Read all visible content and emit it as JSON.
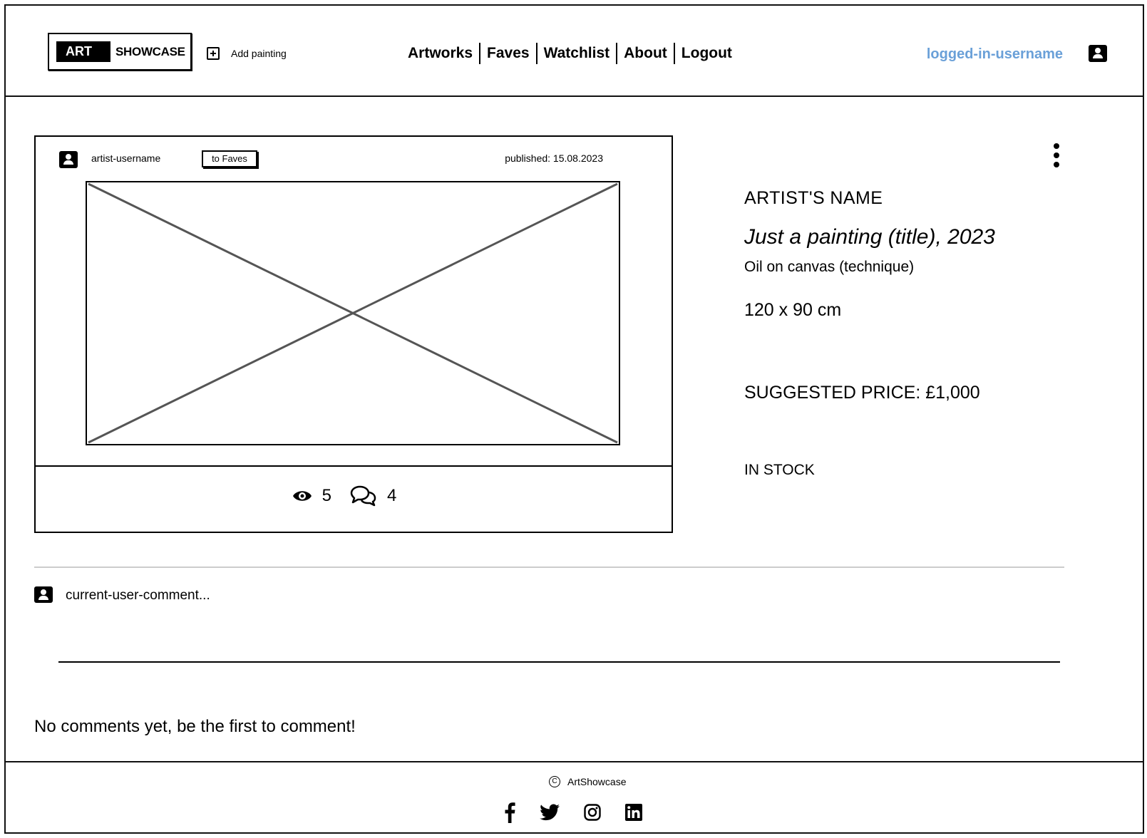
{
  "header": {
    "logo": {
      "part1": "ART",
      "part2": "SHOWCASE"
    },
    "add_painting": "Add painting",
    "nav": [
      "Artworks",
      "Faves",
      "Watchlist",
      "About",
      "Logout"
    ],
    "username": "logged-in-username"
  },
  "card": {
    "artist_username": "artist-username",
    "faves_button": "to Faves",
    "published": "published: 15.08.2023",
    "views": "5",
    "comments": "4"
  },
  "details": {
    "artist_name": "ARTIST'S NAME",
    "title": "Just a painting (title), 2023",
    "technique": "Oil on canvas (technique)",
    "dimensions": "120 x 90 cm",
    "price": "SUGGESTED PRICE: £1,000",
    "stock": "IN STOCK"
  },
  "comment_form": {
    "placeholder": "current-user-comment..."
  },
  "comments": {
    "empty_message": "No comments yet, be the first to comment!"
  },
  "footer": {
    "copyright": "ArtShowcase",
    "socials": [
      "facebook-icon",
      "twitter-icon",
      "instagram-icon",
      "linkedin-icon"
    ]
  },
  "colors": {
    "username": "#6aa0d8",
    "placeholder_lines": "#555555"
  }
}
